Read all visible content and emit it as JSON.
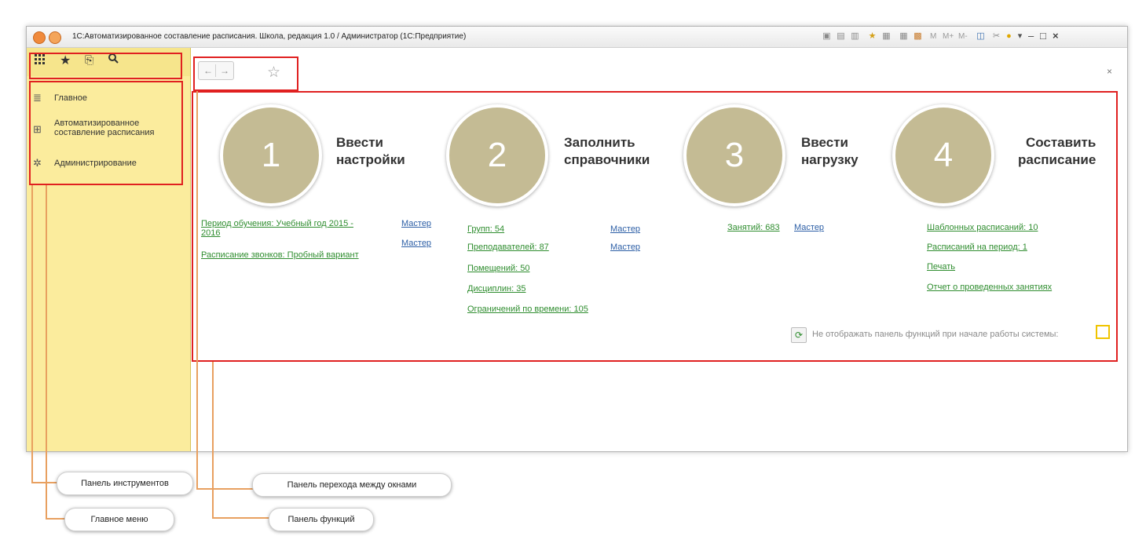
{
  "window": {
    "title": "1С:Автоматизированное составление расписания. Школа, редакция 1.0 / Администратор  (1С:Предприятие)",
    "title_icons": [
      "1c-logo-icon",
      "dropdown-menu-icon"
    ],
    "toolbar_right_text": [
      "M",
      "M+",
      "M-"
    ]
  },
  "sidebar": {
    "toolbar_icons": [
      "apps-grid-icon",
      "star-icon",
      "history-icon",
      "search-icon"
    ],
    "items": [
      {
        "label": "Главное",
        "icon": "list-icon"
      },
      {
        "label": "Автоматизированное составление расписания",
        "icon": "grid-icon"
      },
      {
        "label": "Администрирование",
        "icon": "gear-icon"
      }
    ]
  },
  "nav": {
    "back": "←",
    "forward": "→",
    "favorite": "☆",
    "close": "×"
  },
  "steps": [
    {
      "num": "1",
      "title1": "Ввести",
      "title2": "настройки"
    },
    {
      "num": "2",
      "title1": "Заполнить",
      "title2": "справочники"
    },
    {
      "num": "3",
      "title1": "Ввести",
      "title2": "нагрузку"
    },
    {
      "num": "4",
      "title1": "Составить",
      "title2": "расписание"
    }
  ],
  "col1": {
    "period_line1": "Период обучения: Учебный год 2015 -",
    "period_line2": "2016",
    "bells": "Расписание звонков: Пробный вариант",
    "master1": "Мастер",
    "master2": "Мастер"
  },
  "col2": {
    "groups": "Групп: 54",
    "teachers": "Преподавателей: 87",
    "rooms": "Помещений: 50",
    "subjects": "Дисциплин: 35",
    "limits": "Ограничений по времени: 105",
    "master1": "Мастер",
    "master2": "Мастер"
  },
  "col3": {
    "lessons": "Занятий: 683",
    "master": "Мастер"
  },
  "col4": {
    "templates": "Шаблонных расписаний: 10",
    "periods": "Расписаний на период: 1",
    "print": "Печать",
    "report": "Отчет о проведенных занятиях"
  },
  "footer": {
    "hide_label": "Не отображать панель функций при начале работы системы:",
    "hide_checked": false
  },
  "callouts": {
    "tools": "Панель инструментов",
    "main_menu": "Главное меню",
    "nav_panel": "Панель перехода между окнами",
    "func_panel": "Панель функций"
  },
  "colors": {
    "sidebar_bg": "#fbec9d",
    "link_green": "#2f8d2f",
    "link_blue": "#2d5fa6",
    "circle": "#c4bb94",
    "highlight_red": "#e02020",
    "connector_orange": "#e8a060"
  }
}
